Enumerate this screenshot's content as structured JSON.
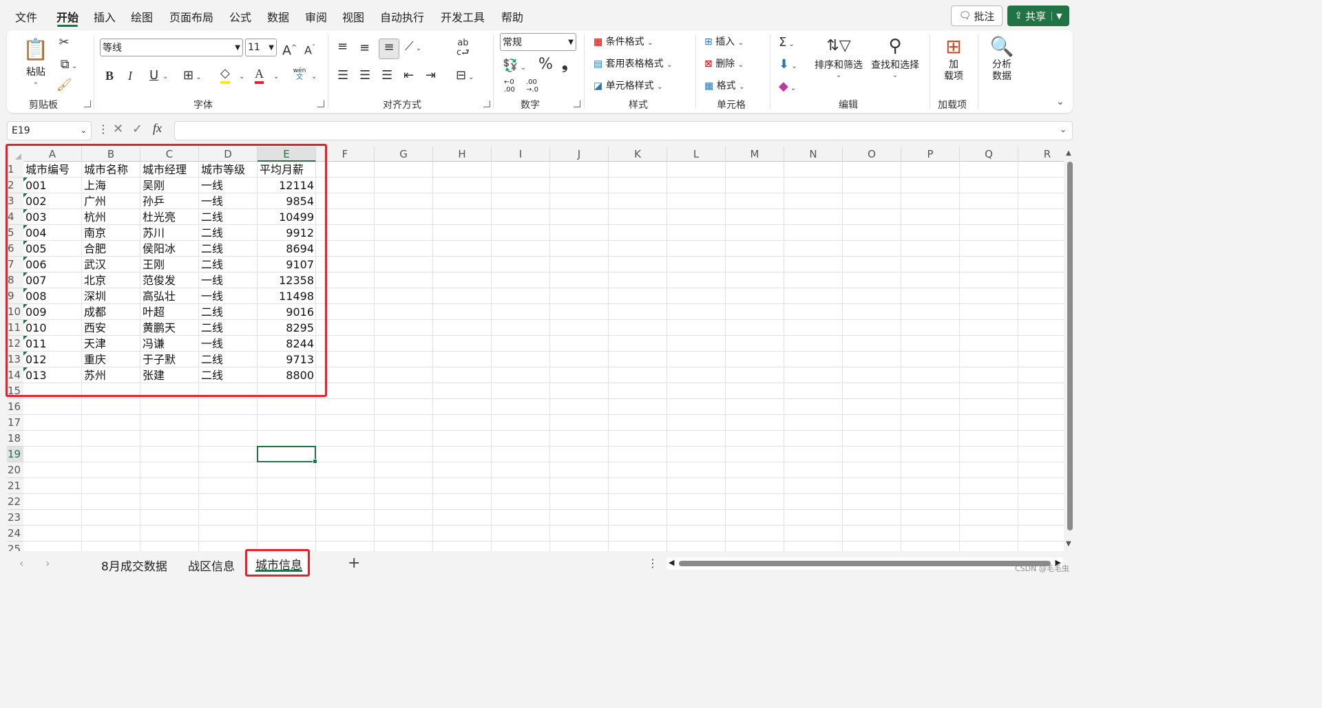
{
  "menu": {
    "items": [
      "文件",
      "开始",
      "插入",
      "绘图",
      "页面布局",
      "公式",
      "数据",
      "审阅",
      "视图",
      "自动执行",
      "开发工具",
      "帮助"
    ],
    "active_index": 1,
    "comment_label": "批注",
    "share_label": "共享"
  },
  "ribbon": {
    "clipboard": {
      "label": "剪贴板",
      "paste_label": "粘贴"
    },
    "font": {
      "label": "字体",
      "font_name": "等线",
      "font_size": "11",
      "bold": "B",
      "italic": "I",
      "underline": "U",
      "phonetic_top": "wén",
      "phonetic_bottom": "文",
      "grow": "A",
      "shrink": "A"
    },
    "alignment": {
      "label": "对齐方式"
    },
    "number": {
      "label": "数字",
      "format": "常规",
      "percent": "%",
      "comma": "❟",
      "inc_decimal": ".00",
      "dec_decimal": ".0"
    },
    "styles": {
      "label": "样式",
      "conditional": "条件格式",
      "table": "套用表格格式",
      "cell_styles": "单元格样式"
    },
    "cells": {
      "label": "单元格",
      "insert": "插入",
      "delete": "删除",
      "format": "格式"
    },
    "editing": {
      "label": "编辑",
      "sort_filter": "排序和筛选",
      "find_select": "查找和选择"
    },
    "addins": {
      "label": "加载项",
      "button_line1": "加",
      "button_line2": "载项"
    },
    "analysis": {
      "button_line1": "分析",
      "button_line2": "数据"
    }
  },
  "formula_bar": {
    "name_box": "E19",
    "fx": "fx",
    "value": ""
  },
  "grid": {
    "columns": [
      "A",
      "B",
      "C",
      "D",
      "E",
      "F",
      "G",
      "H",
      "I",
      "J",
      "K",
      "L",
      "M",
      "N",
      "O",
      "P",
      "Q",
      "R"
    ],
    "rows": [
      "1",
      "2",
      "3",
      "4",
      "5",
      "6",
      "7",
      "8",
      "9",
      "10",
      "11",
      "12",
      "13",
      "14",
      "15",
      "16",
      "17",
      "18",
      "19",
      "20",
      "21",
      "22",
      "23",
      "24",
      "25"
    ],
    "headers": [
      "城市编号",
      "城市名称",
      "城市经理",
      "城市等级",
      "平均月薪"
    ],
    "data": [
      [
        "001",
        "上海",
        "吴刚",
        "一线",
        "12114"
      ],
      [
        "002",
        "广州",
        "孙乒",
        "一线",
        "9854"
      ],
      [
        "003",
        "杭州",
        "杜光亮",
        "二线",
        "10499"
      ],
      [
        "004",
        "南京",
        "苏川",
        "二线",
        "9912"
      ],
      [
        "005",
        "合肥",
        "侯阳冰",
        "二线",
        "8694"
      ],
      [
        "006",
        "武汉",
        "王刚",
        "二线",
        "9107"
      ],
      [
        "007",
        "北京",
        "范俊发",
        "一线",
        "12358"
      ],
      [
        "008",
        "深圳",
        "高弘壮",
        "一线",
        "11498"
      ],
      [
        "009",
        "成都",
        "叶超",
        "二线",
        "9016"
      ],
      [
        "010",
        "西安",
        "黄鹏天",
        "二线",
        "8295"
      ],
      [
        "011",
        "天津",
        "冯谦",
        "一线",
        "8244"
      ],
      [
        "012",
        "重庆",
        "于子默",
        "二线",
        "9713"
      ],
      [
        "013",
        "苏州",
        "张建",
        "二线",
        "8800"
      ]
    ],
    "selected_cell": "E19",
    "accent": "#217346",
    "highlight": "#e8202a"
  },
  "sheets": {
    "tabs": [
      "8月成交数据",
      "战区信息",
      "城市信息"
    ],
    "active_index": 2,
    "add": "+",
    "more": "⋮"
  },
  "watermark": "CSDN @毛毛虫"
}
